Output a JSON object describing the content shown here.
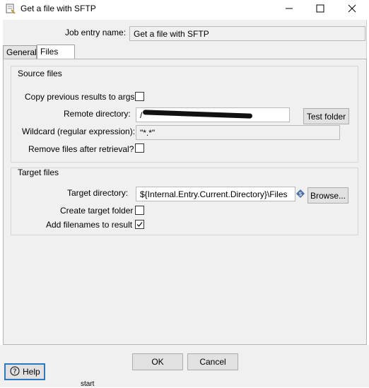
{
  "window": {
    "title": "Get a file with SFTP"
  },
  "job_entry": {
    "label": "Job entry name:",
    "value": "Get a file with SFTP"
  },
  "tabs": [
    {
      "label": "General",
      "active": false
    },
    {
      "label": "Files",
      "active": true
    }
  ],
  "source_files": {
    "group_label": "Source files",
    "copy_previous_label": "Copy previous results to args",
    "copy_previous_checked": false,
    "remote_directory_label": "Remote directory:",
    "remote_directory_value": "/",
    "test_folder_button": "Test folder",
    "wildcard_label": "Wildcard (regular expression):",
    "wildcard_value": "\"*.*\"",
    "remove_files_label": "Remove files after retrieval?",
    "remove_files_checked": false
  },
  "target_files": {
    "group_label": "Target files",
    "target_directory_label": "Target directory:",
    "target_directory_value": "${Internal.Entry.Current.Directory}\\Files",
    "browse_button": "Browse...",
    "create_target_label": "Create target folder",
    "create_target_checked": false,
    "add_filenames_label": "Add filenames to result",
    "add_filenames_checked": true
  },
  "buttons": {
    "ok": "OK",
    "cancel": "Cancel",
    "help": "Help"
  },
  "background_text": "start",
  "icons": [
    "app-icon",
    "minimize-icon",
    "maximize-icon",
    "close-icon",
    "variable-icon",
    "help-icon",
    "checkmark-icon"
  ]
}
